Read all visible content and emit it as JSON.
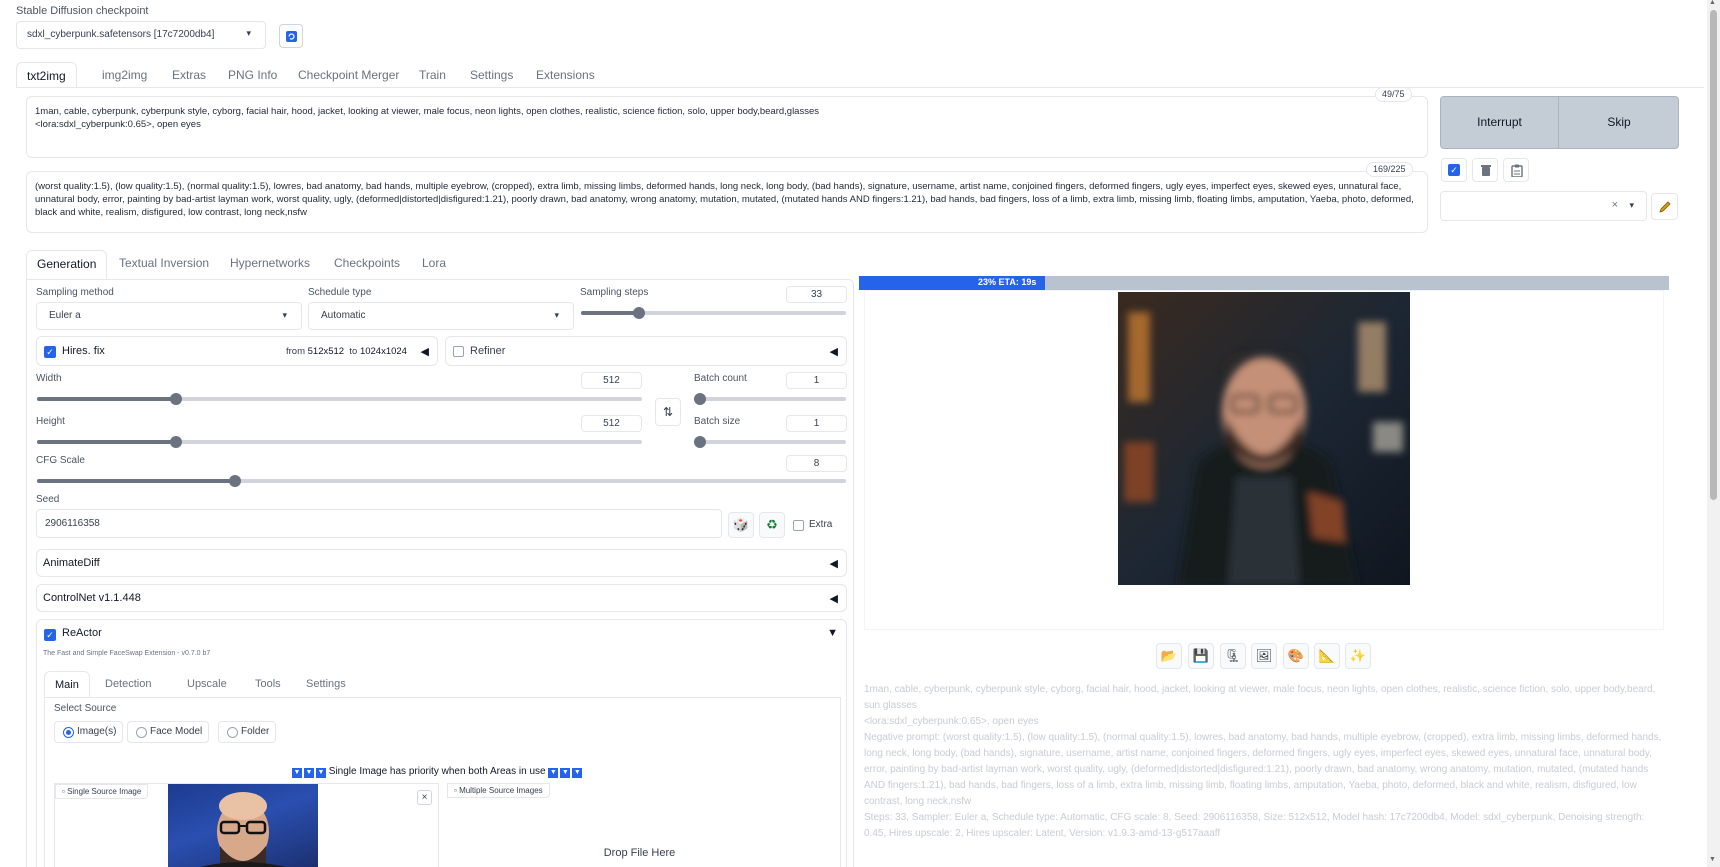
{
  "checkpoint": {
    "label": "Stable Diffusion checkpoint",
    "value": "sdxl_cyberpunk.safetensors [17c7200db4]",
    "refresh_icon": "refresh-icon"
  },
  "main_tabs": [
    "txt2img",
    "img2img",
    "Extras",
    "PNG Info",
    "Checkpoint Merger",
    "Train",
    "Settings",
    "Extensions"
  ],
  "prompt": {
    "text": "1man, cable, cyberpunk, cyberpunk style, cyborg, facial hair, hood, jacket, looking at viewer, male focus, neon lights, open clothes, realistic, science fiction, solo, upper body,beard,glasses\n<lora:sdxl_cyberpunk:0.65>, open eyes",
    "token_count": "49/75"
  },
  "negative_prompt": {
    "text": "(worst quality:1.5), (low quality:1.5), (normal quality:1.5), lowres, bad anatomy, bad hands, multiple eyebrow, (cropped), extra limb, missing limbs, deformed hands, long neck, long body, (bad hands), signature, username, artist name, conjoined fingers, deformed fingers, ugly eyes, imperfect eyes, skewed eyes, unnatural face, unnatural body, error, painting by bad-artist layman work, worst quality, ugly, (deformed|distorted|disfigured:1.21), poorly drawn, bad anatomy, wrong anatomy, mutation, mutated, (mutated hands AND fingers:1.21), bad hands, bad fingers, loss of a limb, extra limb, missing limb, floating limbs, amputation, Yaeba, photo, deformed, black and white, realism, disfigured, low contrast, long neck,nsfw",
    "token_count": "169/225"
  },
  "actions": {
    "interrupt": "Interrupt",
    "skip": "Skip"
  },
  "style_tools": {
    "check_icon": "checkbox-icon",
    "trash_icon": "trash-icon",
    "clipboard_icon": "clipboard-icon",
    "clear_symbol": "×",
    "edit_icon": "pencil-icon"
  },
  "sub_tabs": [
    "Generation",
    "Textual Inversion",
    "Hypernetworks",
    "Checkpoints",
    "Lora"
  ],
  "sampling": {
    "method_label": "Sampling method",
    "method_value": "Euler a",
    "schedule_label": "Schedule type",
    "schedule_value": "Automatic",
    "steps_label": "Sampling steps",
    "steps_value": "33",
    "steps_fraction": 0.22
  },
  "hires": {
    "label": "Hires. fix",
    "checked": true,
    "from_text": "from",
    "from_value": "512x512",
    "to_text": "to",
    "to_value": "1024x1024"
  },
  "refiner": {
    "label": "Refiner",
    "checked": false
  },
  "width": {
    "label": "Width",
    "value": "512",
    "fraction": 0.23
  },
  "height": {
    "label": "Height",
    "value": "512",
    "fraction": 0.23
  },
  "batch_count": {
    "label": "Batch count",
    "value": "1",
    "fraction": 0.0
  },
  "batch_size": {
    "label": "Batch size",
    "value": "1",
    "fraction": 0.0
  },
  "cfg": {
    "label": "CFG Scale",
    "value": "8",
    "fraction": 0.245
  },
  "seed": {
    "label": "Seed",
    "value": "2906116358",
    "extra_label": "Extra"
  },
  "accordions": {
    "animatediff": "AnimateDiff",
    "controlnet": "ControlNet v1.1.448"
  },
  "reactor": {
    "label": "ReActor",
    "subtitle": "The Fast and Simple FaceSwap Extension - v0.7.0 b7",
    "tabs": [
      "Main",
      "Detection",
      "Upscale",
      "Tools",
      "Settings"
    ],
    "select_source_label": "Select Source",
    "source_options": [
      "Image(s)",
      "Face Model",
      "Folder"
    ],
    "priority_note": "Single Image has priority when both Areas in use",
    "single_source_label": "Single Source Image",
    "multiple_source_label": "Multiple Source Images",
    "drop_text": "Drop File Here",
    "close_symbol": "×"
  },
  "progress": {
    "text": "23% ETA: 19s",
    "fraction": 0.23
  },
  "gallery_tools": [
    "folder-icon",
    "save-icon",
    "zip-icon",
    "image-icon",
    "palette-icon",
    "ruler-icon",
    "sparkle-icon"
  ],
  "generation_info": {
    "prompt": "1man, cable, cyberpunk, cyberpunk style, cyborg, facial hair, hood, jacket, looking at viewer, male focus, neon lights, open clothes, realistic, science fiction, solo, upper body,beard, sun glasses",
    "lora": "<lora:sdxl_cyberpunk:0.65>, open eyes",
    "negative": "Negative prompt: (worst quality:1.5), (low quality:1.5), (normal quality:1.5), lowres, bad anatomy, bad hands, multiple eyebrow, (cropped), extra limb, missing limbs, deformed hands, long neck, long body, (bad hands), signature, username, artist name, conjoined fingers, deformed fingers, ugly eyes, imperfect eyes, skewed eyes, unnatural face, unnatural body, error, painting by bad-artist layman work, worst quality, ugly, (deformed|distorted|disfigured:1.21), poorly drawn, bad anatomy, wrong anatomy, mutation, mutated, (mutated hands AND fingers:1.21), bad hands, bad fingers, loss of a limb, extra limb, missing limb, floating limbs, amputation, Yaeba, photo, deformed, black and white, realism, disfigured, low contrast, long neck,nsfw",
    "params": "Steps: 33, Sampler: Euler a, Schedule type: Automatic, CFG scale: 8, Seed: 2906116358, Size: 512x512, Model hash: 17c7200db4, Model: sdxl_cyberpunk, Denoising strength: 0.45, Hires upscale: 2, Hires upscaler: Latent, Version: v1.9.3-amd-13-g517aaaff"
  },
  "colors": {
    "accent": "#2563eb",
    "progress_bg": "#b9c3d0",
    "action_bg": "#c4ccd6"
  }
}
